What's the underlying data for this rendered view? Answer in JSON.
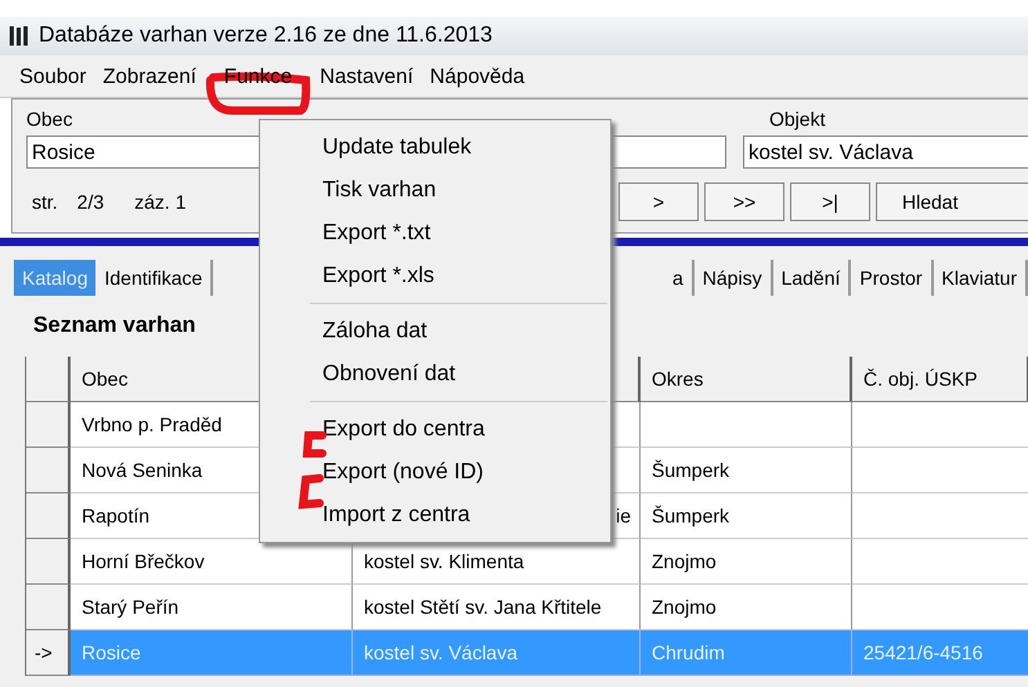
{
  "window": {
    "title": "Databáze varhan verze 2.16 ze dne 11.6.2013"
  },
  "menubar": [
    "Soubor",
    "Zobrazení",
    "Funkce",
    "Nastavení",
    "Nápověda"
  ],
  "menu": {
    "groups": [
      [
        "Update tabulek",
        "Tisk varhan",
        "Export *.txt",
        "Export *.xls"
      ],
      [
        "Záloha dat",
        "Obnovení dat"
      ],
      [
        "Export do centra",
        "Export (nové ID)",
        "Import z centra"
      ]
    ]
  },
  "filter": {
    "obec_label": "Obec",
    "obec_value": "Rosice",
    "objekt_label": "Objekt",
    "objekt_value": "kostel sv. Václava"
  },
  "navigation": {
    "page_label": "str.",
    "page": "2/3",
    "record": "záz. 1",
    "buttons": [
      ">",
      ">>",
      ">|"
    ],
    "search_button": "Hledat"
  },
  "tabs": [
    {
      "label": "Katalog",
      "selected": true
    },
    {
      "label": "Identifikace",
      "selected": false
    },
    {
      "label": "a",
      "selected": false
    },
    {
      "label": "Nápisy",
      "selected": false
    },
    {
      "label": "Ladění",
      "selected": false
    },
    {
      "label": "Prostor",
      "selected": false
    },
    {
      "label": "Klaviatur",
      "selected": false
    }
  ],
  "list_title": "Seznam varhan",
  "table": {
    "columns": {
      "obec": "Obec",
      "okres": "Okres",
      "c_obj": "Č. obj. ÚSKP"
    },
    "rows": [
      {
        "obec": "Vrbno p. Praděd",
        "selected": false
      },
      {
        "obec": "Nová Seninka",
        "okres": "Šumperk",
        "selected": false
      },
      {
        "obec": "Rapotín",
        "column_2": "ie",
        "okres": "Šumperk",
        "selected": false
      },
      {
        "obec": "Horní Břečkov",
        "column_2": "kostel sv. Klimenta",
        "okres": "Znojmo",
        "selected": false
      },
      {
        "obec": "Starý Peřín",
        "column_2": "kostel Stětí sv. Jana Křtitele",
        "okres": "Znojmo",
        "selected": false
      },
      {
        "indicator": "->",
        "obec": "Rosice",
        "column_2": "kostel sv. Václava",
        "okres": "Chrudim",
        "c_obj": "25421/6-4516",
        "selected": true
      }
    ]
  }
}
